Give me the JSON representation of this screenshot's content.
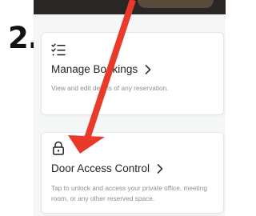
{
  "step": {
    "number": "2."
  },
  "cards": [
    {
      "icon": "list-checklist-icon",
      "title": "Manage Bookings",
      "description": "View and edit details of any reservation."
    },
    {
      "icon": "padlock-icon",
      "title": "Door Access Control",
      "description": "Tap to unlock and access your private office, meeting room, or any other reserved space."
    }
  ],
  "annotation": {
    "arrow_color": "#e8392b"
  },
  "colors": {
    "card_background": "#ffffff",
    "screen_background": "#f5f6f7",
    "title": "#1f2326",
    "description": "#8a8f94"
  }
}
